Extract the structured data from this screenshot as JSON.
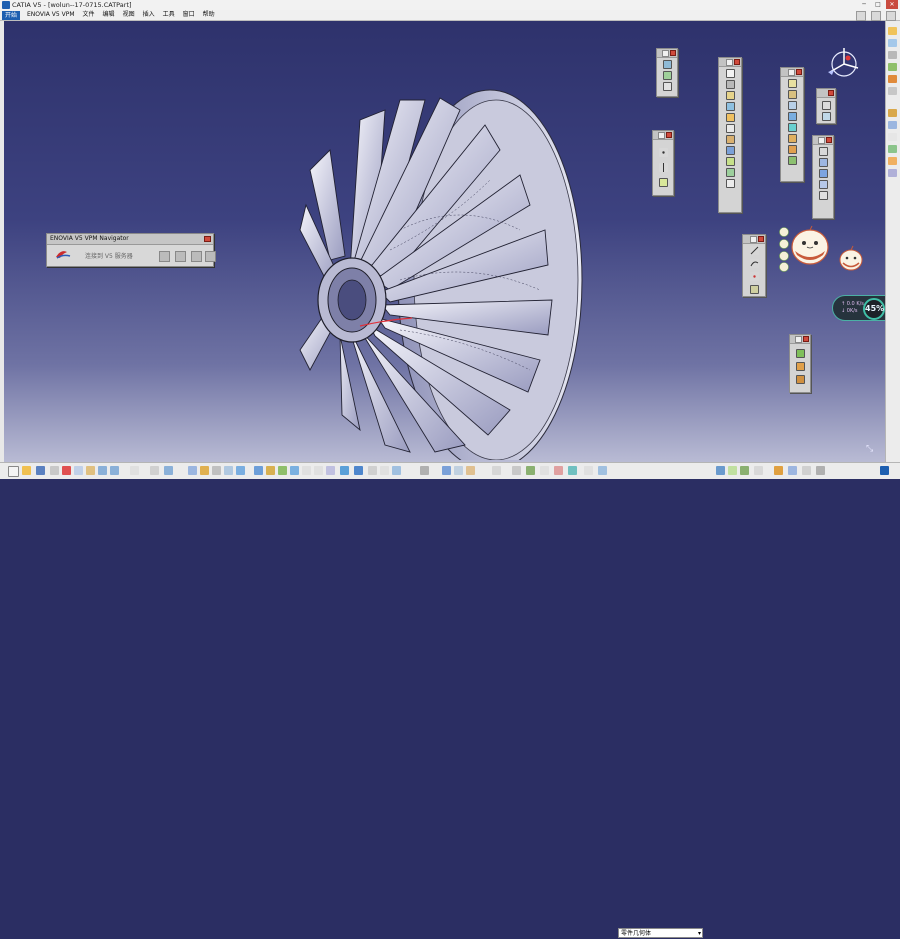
{
  "window": {
    "title": "CATIA V5 - [wolun--17-0715.CATPart]",
    "controls": [
      "─",
      "□",
      "✕"
    ]
  },
  "menubar": {
    "start": "开始",
    "items": [
      "ENOVIA V5 VPM",
      "文件",
      "编辑",
      "视图",
      "插入",
      "工具",
      "窗口",
      "帮助"
    ]
  },
  "navigator": {
    "title": "ENOVIA V5 VPM Navigator",
    "logo_text": "ENOVIA",
    "connect_label": "连接到 V5 服务器"
  },
  "workbench_select": {
    "value": "零件几何体"
  },
  "net_meter": {
    "up": "↑ 0.0 K/s",
    "down": "↓ 0K/s",
    "percent": "45%"
  },
  "colors": {
    "viewport_top": "#2e326c",
    "viewport_bottom": "#b9bbd4",
    "accent": "#1e5fb0",
    "close": "#d04a3c"
  },
  "icons": {
    "compass": "compass-icon",
    "model": "impeller-model",
    "assistant": "robot-mascot-icon"
  }
}
